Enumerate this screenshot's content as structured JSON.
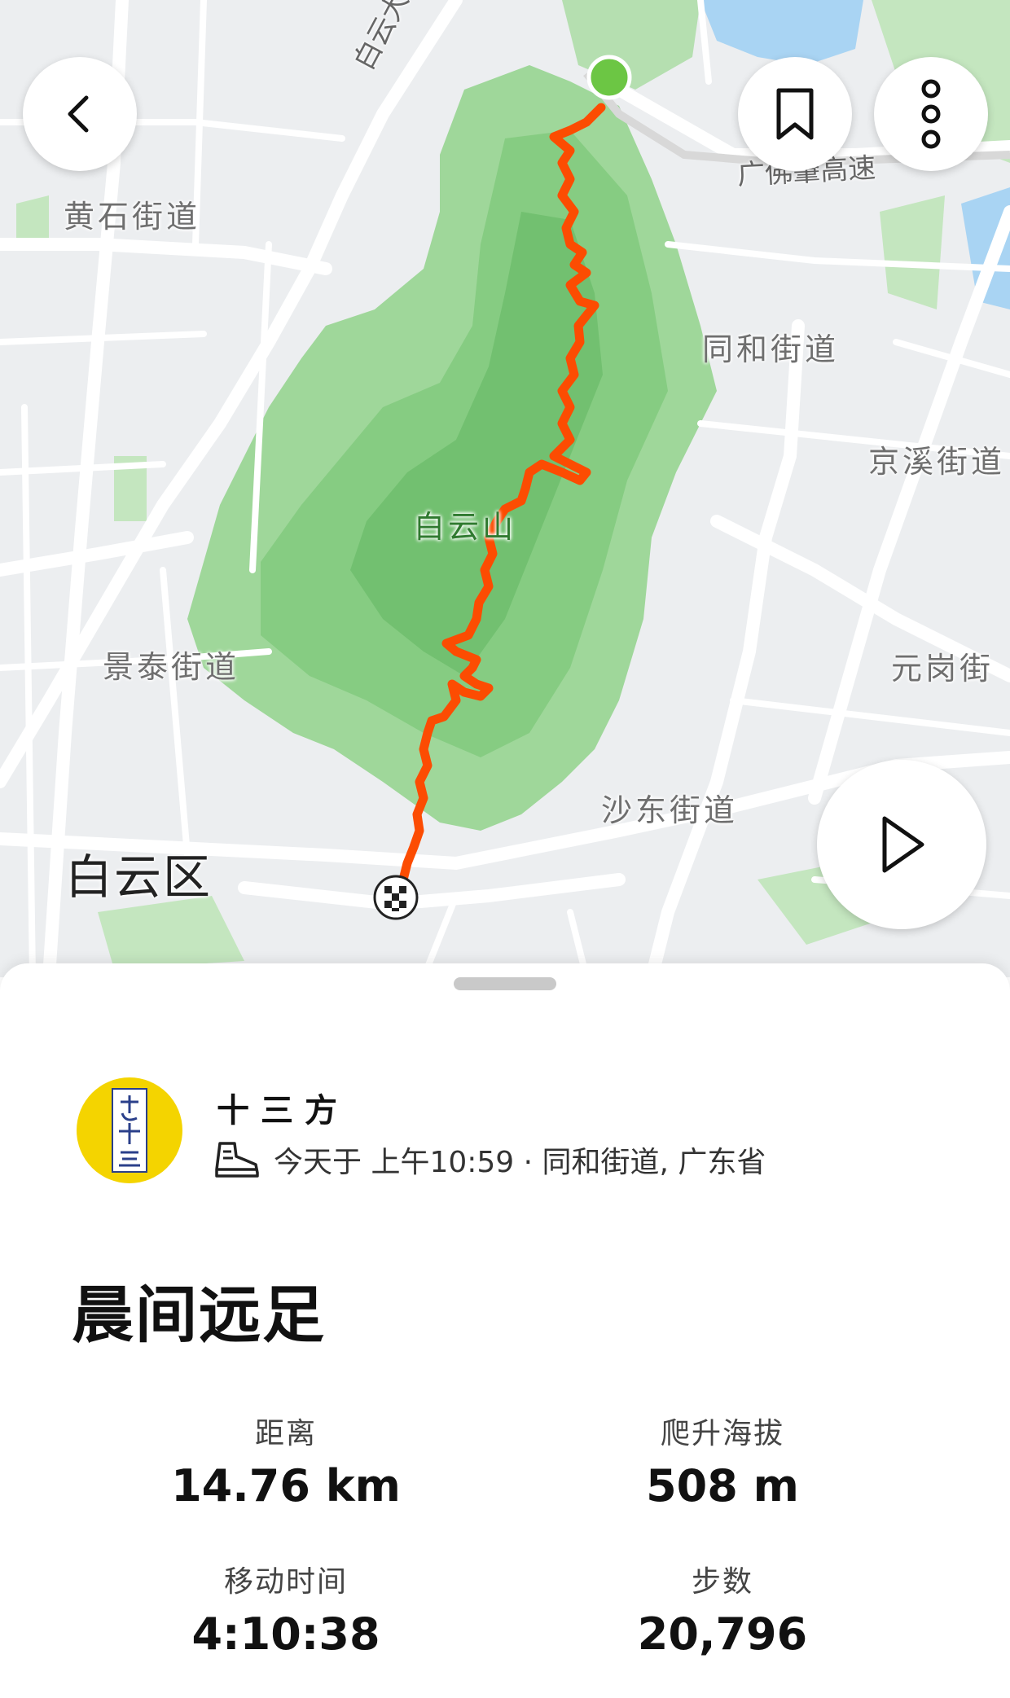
{
  "map": {
    "places": {
      "huangshi": "黄石街道",
      "tonghe": "同和街道",
      "jingxi": "京溪街道",
      "jingtai": "景泰街道",
      "yuangang": "元岗街",
      "shadong": "沙东街道",
      "baiyunshan": "白云山",
      "district": "白云区"
    },
    "roads": {
      "baiyun_avenue_north": "白云大道北",
      "guangfo_expressway": "广佛肇高速"
    },
    "route_color": "#fc4c02",
    "start_marker_color": "#6cc644"
  },
  "buttons": {
    "back": "back-arrow",
    "bookmark": "bookmark",
    "more": "more-options",
    "play": "play-flyover"
  },
  "activity": {
    "athlete_name": "十三方",
    "avatar_text": "方十三",
    "meta": "今天于 上午10:59 · 同和街道, 广东省",
    "activity_icon": "hiking-shoe-icon",
    "title": "晨间远足"
  },
  "stats": [
    {
      "label": "距离",
      "value": "14.76 km"
    },
    {
      "label": "爬升海拔",
      "value": "508 m"
    },
    {
      "label": "移动时间",
      "value": "4:10:38"
    },
    {
      "label": "步数",
      "value": "20,796"
    }
  ]
}
